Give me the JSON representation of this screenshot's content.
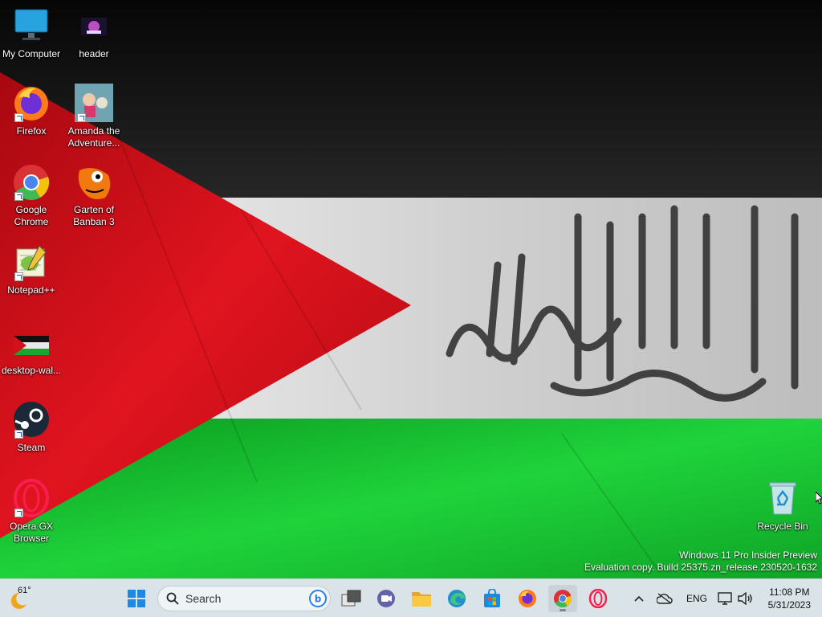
{
  "desktop": {
    "icons": [
      {
        "label": "My Computer",
        "icon": "monitor-icon"
      },
      {
        "label": "header",
        "icon": "image-file-icon"
      },
      {
        "label": "Firefox",
        "icon": "firefox-icon"
      },
      {
        "label": "Amanda the Adventure...",
        "icon": "game-icon"
      },
      {
        "label": "Google Chrome",
        "icon": "chrome-icon"
      },
      {
        "label": "Garten of Banban 3",
        "icon": "game-icon"
      },
      {
        "label": "Notepad++",
        "icon": "notepad-plus-plus-icon"
      },
      {
        "label": "desktop-wal...",
        "icon": "image-file-icon"
      },
      {
        "label": "Steam",
        "icon": "steam-icon"
      },
      {
        "label": "Opera GX Browser",
        "icon": "opera-gx-icon"
      },
      {
        "label": "Recycle Bin",
        "icon": "recycle-bin-icon"
      }
    ],
    "watermark": {
      "line1": "Windows 11 Pro Insider Preview",
      "line2": "Evaluation copy. Build 25375.zn_release.230520-1632"
    }
  },
  "taskbar": {
    "weather": {
      "temp": "61°"
    },
    "search_label": "Search",
    "pinned": [
      "start",
      "search",
      "task-view",
      "teams",
      "file-explorer",
      "edge",
      "store",
      "firefox",
      "chrome",
      "opera-gx"
    ],
    "tray": {
      "language": "ENG"
    },
    "clock": {
      "time": "11:08 PM",
      "date": "5/31/2023"
    }
  },
  "colors": {
    "flag_black": "#151515",
    "flag_white": "#dcdcdc",
    "flag_green": "#16b82a",
    "flag_red": "#d4101a",
    "taskbar_bg": "#d9e3e8"
  }
}
